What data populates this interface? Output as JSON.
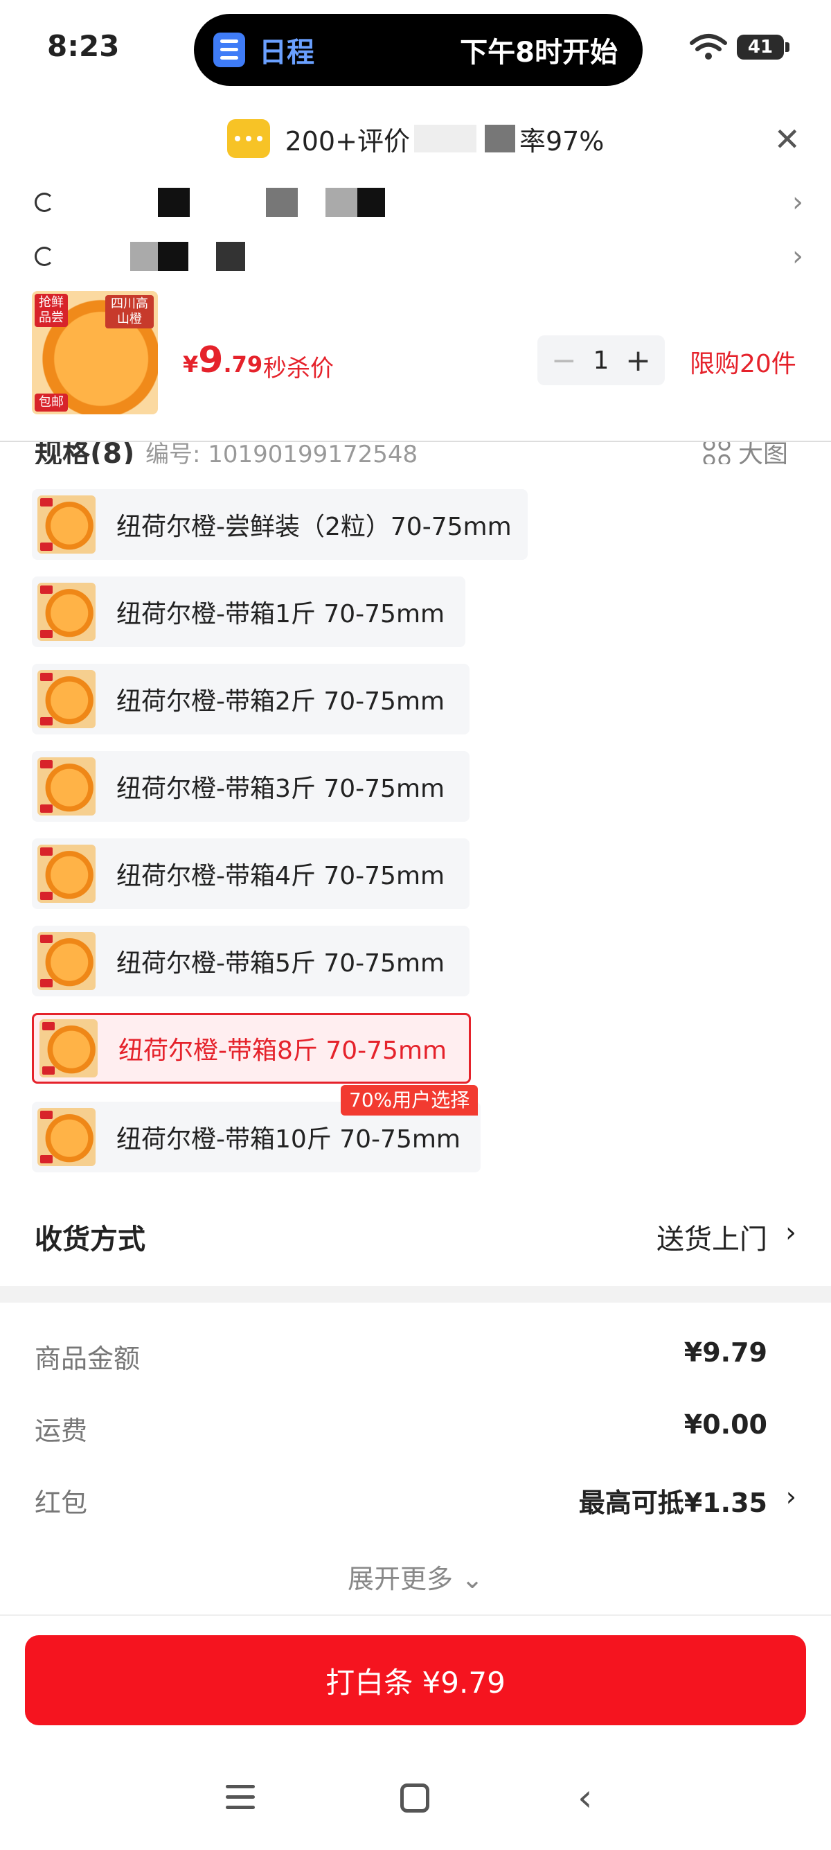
{
  "status_bar": {
    "time": "8:23",
    "island_title": "日程",
    "island_event": "下午8时开始",
    "battery": "41"
  },
  "review_banner": {
    "text_start": "200+评价",
    "text_end": "率97%"
  },
  "product": {
    "thumb_badge": "抢鲜品尝",
    "thumb_title": "四川高山橙",
    "thumb_bottom": "包邮",
    "price_symbol": "¥",
    "price_int": "9",
    "price_dec": ".79",
    "price_label": "秒杀价",
    "quantity": "1",
    "limit": "限购20件"
  },
  "spec": {
    "label": "规格(8)",
    "sku": "编号: 10190199172548",
    "big_image_label": "大图"
  },
  "variants": [
    {
      "label": "纽荷尔橙-尝鲜装（2粒）70-75mm",
      "selected": false
    },
    {
      "label": "纽荷尔橙-带箱1斤  70-75mm",
      "selected": false
    },
    {
      "label": "纽荷尔橙-带箱2斤  70-75mm",
      "selected": false
    },
    {
      "label": "纽荷尔橙-带箱3斤  70-75mm",
      "selected": false
    },
    {
      "label": "纽荷尔橙-带箱4斤  70-75mm",
      "selected": false
    },
    {
      "label": "纽荷尔橙-带箱5斤  70-75mm",
      "selected": false
    },
    {
      "label": "纽荷尔橙-带箱8斤  70-75mm",
      "selected": true
    },
    {
      "label": "纽荷尔橙-带箱10斤  70-75mm",
      "selected": false
    }
  ],
  "popular_tag": "70%用户选择",
  "delivery": {
    "label": "收货方式",
    "value": "送货上门"
  },
  "costs": {
    "goods_label": "商品金额",
    "goods_value": "¥9.79",
    "shipping_label": "运费",
    "shipping_value": "¥0.00",
    "redpacket_label": "红包",
    "redpacket_value": "最高可抵¥1.35"
  },
  "expand_more": "展开更多 ⌄",
  "pay_button": "打白条 ¥9.79",
  "colors": {
    "accent": "#e5222b",
    "pay_button": "#f5141f"
  }
}
